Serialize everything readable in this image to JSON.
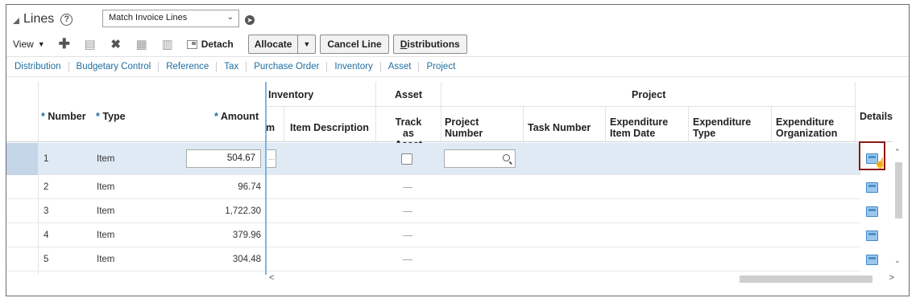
{
  "header": {
    "title": "Lines",
    "help_icon": "?",
    "action_select": {
      "value": "Match Invoice Lines"
    }
  },
  "toolbar": {
    "view_label": "View",
    "detach_label": "Detach",
    "allocate_label": "Allocate",
    "cancel_line_label": "Cancel Line",
    "distributions_label": "Distributions",
    "icons": [
      "add-icon",
      "edit-icon",
      "delete-icon",
      "freeze-icon",
      "wrap-icon",
      "detach-icon"
    ]
  },
  "tabs": [
    "Distribution",
    "Budgetary Control",
    "Reference",
    "Tax",
    "Purchase Order",
    "Inventory",
    "Asset",
    "Project"
  ],
  "table": {
    "group_headers": {
      "inventory": "Inventory",
      "asset": "Asset",
      "project": "Project"
    },
    "columns": {
      "number": "Number",
      "type": "Type",
      "amount": "Amount",
      "item_partial": "m",
      "item_description": "Item Description",
      "track_as_asset": "Track as Asset",
      "project_number": "Project Number",
      "task_number": "Task Number",
      "expenditure_item_date": "Expenditure Item Date",
      "expenditure_type": "Expenditure Type",
      "expenditure_organization": "Expenditure Organization",
      "details": "Details"
    },
    "required_marker": "*",
    "rows": [
      {
        "number": "1",
        "type": "Item",
        "amount": "504.67",
        "item": "...",
        "selected": true
      },
      {
        "number": "2",
        "type": "Item",
        "amount": "96.74",
        "item": "",
        "selected": false
      },
      {
        "number": "3",
        "type": "Item",
        "amount": "1,722.30",
        "item": "",
        "selected": false
      },
      {
        "number": "4",
        "type": "Item",
        "amount": "379.96",
        "item": "",
        "selected": false
      },
      {
        "number": "5",
        "type": "Item",
        "amount": "304.48",
        "item": "",
        "selected": false
      }
    ]
  },
  "colors": {
    "link": "#1f6ea0",
    "selected_row": "#dfeaf5",
    "highlight_border": "#8b1a14",
    "detail_icon": "#9cc7ec"
  }
}
